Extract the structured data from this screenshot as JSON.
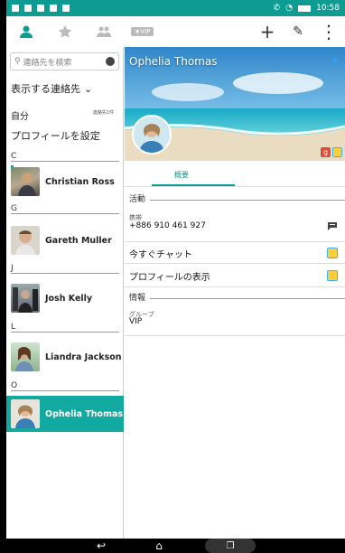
{
  "status_bar": {
    "time": "10:58"
  },
  "toolbar": {
    "vip_label": "VIP",
    "add_label": "+",
    "edit_label": "✎",
    "more_label": "⋮"
  },
  "left": {
    "search_placeholder": "連絡先を検索",
    "filter_label": "表示する連絡先",
    "own_label": "自分",
    "own_count": "連絡先1件",
    "set_profile": "プロフィールを設定",
    "sections": [
      {
        "letter": "C",
        "name": "Christian Ross"
      },
      {
        "letter": "G",
        "name": "Gareth Muller"
      },
      {
        "letter": "J",
        "name": "Josh Kelly"
      },
      {
        "letter": "L",
        "name": "Liandra Jackson"
      },
      {
        "letter": "O",
        "name": "Ophelia Thomas"
      }
    ]
  },
  "detail": {
    "name": "Ophelia Thomas",
    "tab": "概要",
    "activity_header": "活動",
    "phone_label": "携帯",
    "phone_value": "+886 910 461 927",
    "chat_now": "今すぐチャット",
    "show_profile": "プロフィールの表示",
    "info_header": "情報",
    "group_label": "グループ",
    "group_value": "VIP"
  },
  "colors": {
    "accent": "#0e9b92",
    "selected": "#11a9a0"
  }
}
